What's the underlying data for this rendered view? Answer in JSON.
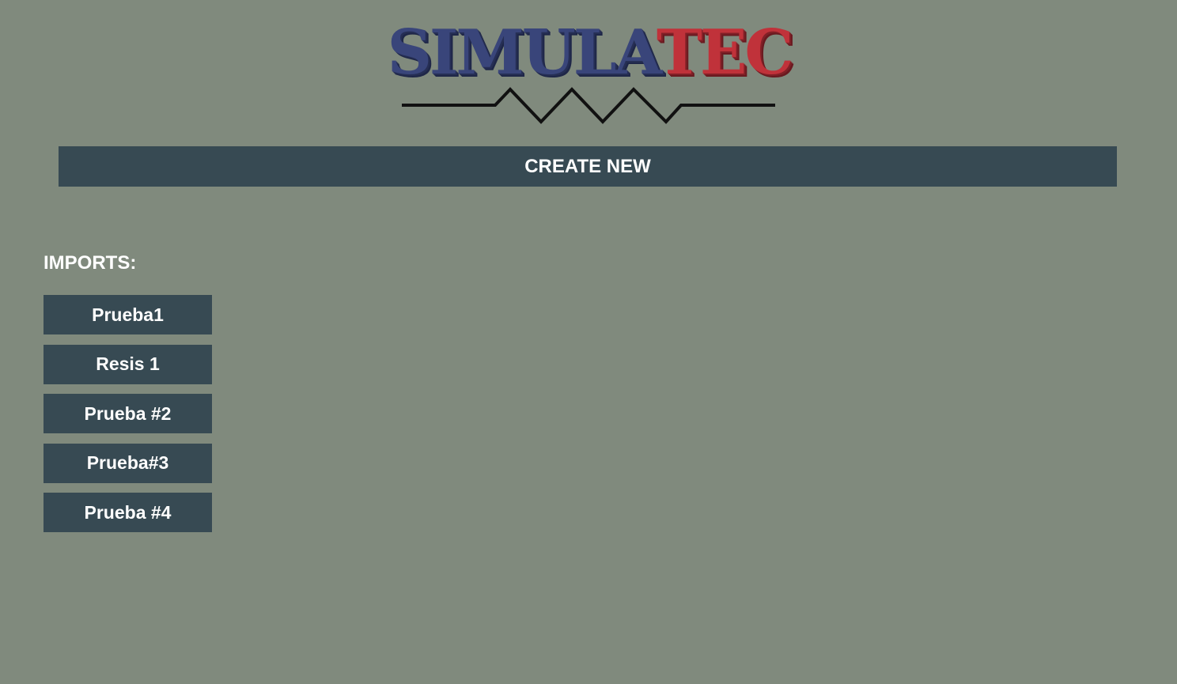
{
  "logo": {
    "text_blue": "SIMULA",
    "text_red": "TEC",
    "icon": "resistor-zigzag-icon",
    "colors": {
      "blue": "#39457a",
      "red": "#c0323a",
      "line": "#111111"
    }
  },
  "header": {
    "create_label": "CREATE NEW"
  },
  "imports": {
    "label": "IMPORTS:",
    "items": [
      {
        "label": "Prueba1"
      },
      {
        "label": "Resis 1"
      },
      {
        "label": "Prueba #2"
      },
      {
        "label": "Prueba#3"
      },
      {
        "label": "Prueba #4"
      }
    ]
  },
  "theme": {
    "background": "#808a7d",
    "button": "#374a53",
    "text": "#ffffff"
  }
}
